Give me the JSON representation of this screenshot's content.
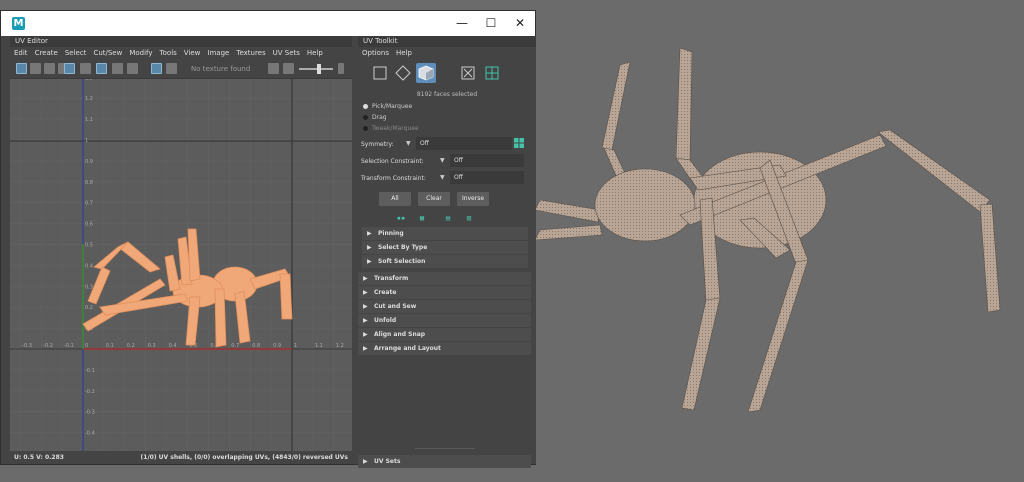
{
  "window": {
    "app_icon_letter": "M",
    "minimize_glyph": "—",
    "maximize_glyph": "☐",
    "close_glyph": "✕"
  },
  "uv_editor": {
    "panel_title": "UV Editor",
    "menu": [
      "Edit",
      "Create",
      "Select",
      "Cut/Sew",
      "Modify",
      "Tools",
      "View",
      "Image",
      "Textures",
      "UV Sets",
      "Help"
    ],
    "texture_placeholder": "No texture found",
    "axis_labels_h": [
      "-0.3",
      "-0.2",
      "-0.1",
      "0",
      "0.1",
      "0.2",
      "0.3",
      "0.4",
      "0.5",
      "0.6",
      "0.7",
      "0.8",
      "0.9",
      "1",
      "1.1",
      "1.2"
    ],
    "axis_labels_v": [
      "1.3",
      "1.2",
      "1.1",
      "1",
      "0.9",
      "0.8",
      "0.7",
      "0.6",
      "0.5",
      "0.4",
      "0.3",
      "0.2",
      "0.1",
      "0",
      "-0.1",
      "-0.2",
      "-0.3",
      "-0.4"
    ],
    "coords": "U:  0.5 V:  0.283",
    "stats": "(1/0) UV shells, (0/0) overlapping UVs, (4843/0) reversed UVs",
    "uv_color": "#f0a878"
  },
  "uv_toolkit": {
    "panel_title": "UV Toolkit",
    "menu": [
      "Options",
      "Help"
    ],
    "faces_selected": "8192 faces selected",
    "modes": [
      {
        "label": "Pick/Marquee",
        "state": "on"
      },
      {
        "label": "Drag",
        "state": "off"
      },
      {
        "label": "Tweak/Marquee",
        "state": "dim"
      }
    ],
    "symmetry": {
      "label": "Symmetry:",
      "value": "Off"
    },
    "selection_constraint": {
      "label": "Selection Constraint:",
      "value": "Off"
    },
    "transform_constraint": {
      "label": "Transform Constraint:",
      "value": "Off"
    },
    "buttons": {
      "all": "All",
      "clear": "Clear",
      "inverse": "Inverse"
    },
    "subsections": [
      "Pinning",
      "Select By Type",
      "Soft Selection"
    ],
    "sections": [
      "Transform",
      "Create",
      "Cut and Sew",
      "Unfold",
      "Align and Snap",
      "Arrange and Layout"
    ],
    "uv_sets": "UV Sets",
    "accent": "#45c3a8",
    "selected_icon_color": "#5e8fba"
  }
}
